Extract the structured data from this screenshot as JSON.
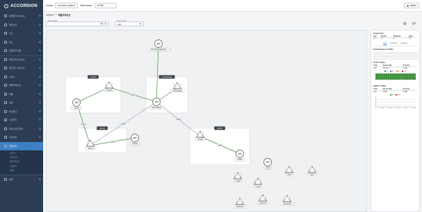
{
  "app": {
    "name": "ACCORDION"
  },
  "topbar": {
    "cluster_label": "Cluster",
    "cluster_value": "member-cluster1",
    "namespace_label": "Namespace",
    "namespace_value": "NONE",
    "user": "admin"
  },
  "breadcrumb": {
    "parent": "토폴로지",
    "separator": ">",
    "current": "애플리케이션"
  },
  "sidebar": {
    "items": [
      {
        "label": "토폴로지 대시보드"
      },
      {
        "label": "클러스터"
      },
      {
        "label": "노드"
      },
      {
        "label": "파드"
      },
      {
        "label": "토폴로지 설정"
      },
      {
        "label": "클러스터 대시보드"
      },
      {
        "label": "워크로드 대시보드"
      },
      {
        "label": "서비스"
      },
      {
        "label": "애플리케이션"
      },
      {
        "label": "볼륨"
      },
      {
        "label": "설정"
      },
      {
        "label": "네트워크"
      },
      {
        "label": "스토리지"
      },
      {
        "label": "레지스트리 관리"
      },
      {
        "label": "모니터링"
      }
    ],
    "active": {
      "label": "토폴로지"
    },
    "subitems": [
      {
        "label": "전체 뷰"
      },
      {
        "label": "서비스 맵"
      },
      {
        "label": "애플리케이션"
      },
      {
        "label": "트래픽 뷰"
      },
      {
        "label": "이벤트"
      }
    ],
    "bottom": {
      "label": "설정"
    }
  },
  "filters": {
    "namespace_label": "Namespace",
    "namespace_count": "4/4",
    "graph_type_label": "Graph Type",
    "graph_type_value": "App"
  },
  "icons": {
    "settings": "gear-icon",
    "refresh": "refresh-icon",
    "user": "user-icon",
    "logo": "accordion-logo-icon"
  },
  "graph": {
    "groups": [
      {
        "name": "reviews"
      },
      {
        "name": "productpage"
      },
      {
        "name": "ratings"
      },
      {
        "name": "details"
      }
    ],
    "app_nodes": [
      {
        "label": "istio-ingressgateway",
        "badge": "APP"
      },
      {
        "label": "reviews",
        "badge": "APP"
      },
      {
        "label": "productpage",
        "badge": "APP"
      },
      {
        "label": "ratings",
        "badge": "APP"
      },
      {
        "label": "details",
        "badge": "APP"
      },
      {
        "label": "mysql",
        "badge": "APP"
      }
    ],
    "workload_nodes": [
      {
        "label": "reviews"
      },
      {
        "label": "productpage"
      },
      {
        "label": "ratings"
      },
      {
        "label": "details"
      },
      {
        "label": "mysql"
      },
      {
        "label": "mysql"
      },
      {
        "label": "part1"
      },
      {
        "label": "part2"
      },
      {
        "label": "product2"
      },
      {
        "label": "product3"
      },
      {
        "label": "productinfo"
      }
    ],
    "edge_labels": [
      "100%",
      "100%",
      "100%",
      "100%",
      "100%",
      "100%"
    ],
    "colors": {
      "edge_ok": "#3f8f3d",
      "edge_idle": "#9aa0a6",
      "node_stroke": "#555555",
      "group_fill": "#ffffff"
    }
  },
  "right_panel": {
    "graph_info_title": "Graph Info",
    "graph_info": {
      "headers": [
        "App",
        "Service",
        "Workload",
        "Edge"
      ],
      "values": [
        "6",
        "17",
        "8",
        "12"
      ]
    },
    "tabs": [
      "Total",
      "Incoming",
      "Outgoing"
    ],
    "total_request_title": "Total Request Traffic",
    "http_title": "HTTP Traffic",
    "http_table": {
      "headers": [
        "Total",
        "Success(%)",
        "Error(%)"
      ],
      "values": [
        "0.04",
        "100.00%",
        "0.00%"
      ]
    },
    "http_legend": [
      "OK",
      "3xx",
      "4xx",
      "5xx"
    ],
    "http_ticks": [
      "0",
      "20",
      "40",
      "60",
      "80",
      "100"
    ],
    "grpc_title": "GRPC Traffic",
    "grpc_table": {
      "headers": [
        "Total",
        "Success(%)",
        "Error(%)"
      ],
      "values": [
        "0.00",
        "0.00%",
        "0.00%"
      ]
    },
    "grpc_legend": [
      "OK",
      "Error"
    ],
    "grpc_ticks": [
      "0",
      "20",
      "40",
      "60",
      "80",
      "100"
    ],
    "colors": {
      "ok": "#3f8f3d",
      "3xx": "#2f6fb6",
      "4xx": "#e0a000",
      "5xx": "#c62828",
      "error": "#c62828"
    }
  }
}
